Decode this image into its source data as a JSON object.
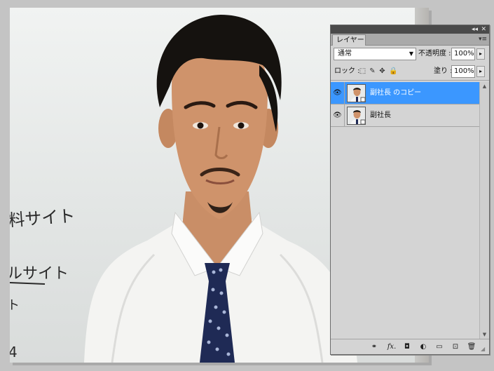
{
  "canvas": {
    "board_text": [
      "料サイト",
      "ルサイト",
      "ト",
      "4"
    ]
  },
  "panel": {
    "collapse_glyph": "◂◂",
    "close_glyph": "✕",
    "tab_label": "レイヤー",
    "menu_glyph": "▾≡",
    "blend_mode": "通常",
    "opacity_label": "不透明度 :",
    "opacity_value": "100%",
    "lock_label": "ロック :",
    "fill_label": "塗り :",
    "fill_value": "100%",
    "arrow_glyph": "▸"
  },
  "layers": [
    {
      "name": "副社長 のコピー",
      "selected": true,
      "visible_glyph": "👁"
    },
    {
      "name": "副社長",
      "selected": false,
      "visible_glyph": "👁"
    }
  ],
  "bottom_icons": {
    "link": "⚭",
    "fx": "fx.",
    "mask": "◘",
    "adjust": "◐",
    "group": "▭",
    "new": "⊡",
    "trash": "🗑"
  }
}
